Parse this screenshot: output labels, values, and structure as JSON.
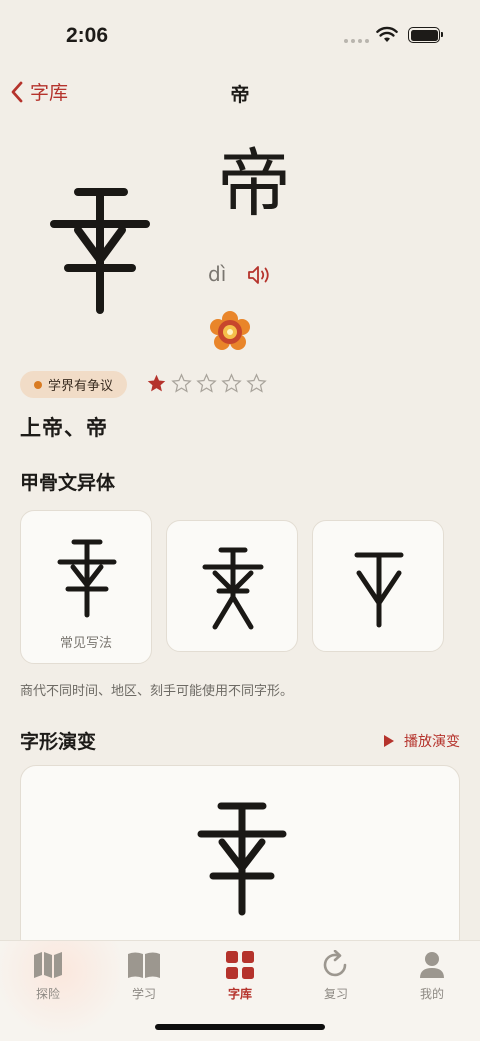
{
  "status_bar": {
    "time": "2:06"
  },
  "nav": {
    "back_label": "字库",
    "title": "帝"
  },
  "character": {
    "modern": "帝",
    "pinyin": "dì"
  },
  "tags": {
    "dispute": "学界有争议",
    "difficulty_rating": 1,
    "difficulty_max": 5
  },
  "meaning": "上帝、帝",
  "variants_section": {
    "title": "甲骨文异体",
    "items": [
      {
        "caption": "常见写法"
      },
      {
        "caption": ""
      },
      {
        "caption": ""
      }
    ],
    "note": "商代不同时间、地区、刻手可能使用不同字形。"
  },
  "evolution_section": {
    "title": "字形演变",
    "play_label": "播放演变"
  },
  "tab_bar": {
    "tabs": [
      {
        "label": "探险",
        "icon": "map-icon"
      },
      {
        "label": "学习",
        "icon": "book-icon"
      },
      {
        "label": "字库",
        "icon": "grid-icon"
      },
      {
        "label": "复习",
        "icon": "refresh-icon"
      },
      {
        "label": "我的",
        "icon": "person-icon"
      }
    ],
    "active_index": 2
  },
  "colors": {
    "accent": "#b5332c",
    "background": "#f2eee7",
    "badge": "#f1dcc7",
    "badge_dot": "#d97b22"
  }
}
